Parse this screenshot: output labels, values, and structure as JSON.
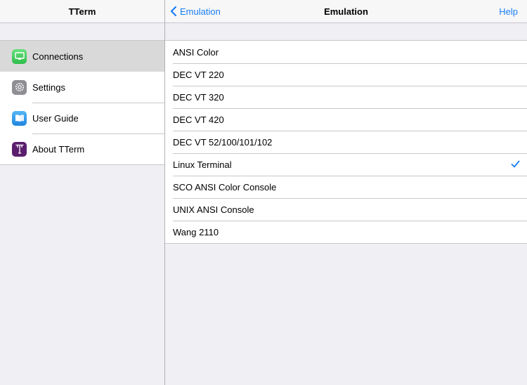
{
  "sidebar": {
    "title": "TTerm",
    "items": [
      {
        "label": "Connections",
        "icon": "monitor-icon",
        "selected": true
      },
      {
        "label": "Settings",
        "icon": "gear-icon",
        "selected": false
      },
      {
        "label": "User Guide",
        "icon": "book-icon",
        "selected": false
      },
      {
        "label": "About TTerm",
        "icon": "tterm-logo-icon",
        "selected": false
      }
    ]
  },
  "header": {
    "back_label": "Emulation",
    "title": "Emulation",
    "help_label": "Help"
  },
  "emulations": {
    "options": [
      {
        "label": "ANSI Color"
      },
      {
        "label": "DEC VT 220"
      },
      {
        "label": "DEC VT 320"
      },
      {
        "label": "DEC VT 420"
      },
      {
        "label": "DEC VT 52/100/101/102"
      },
      {
        "label": "Linux Terminal"
      },
      {
        "label": "SCO ANSI Color Console"
      },
      {
        "label": "UNIX ANSI Console"
      },
      {
        "label": "Wang 2110"
      }
    ],
    "selected": "Linux Terminal"
  },
  "colors": {
    "accent": "#1a7ef5",
    "connections_icon": "#4cd964",
    "settings_icon": "#8e8e93",
    "guide_icon": "#2a9af0",
    "about_icon": "#5b1e6e"
  }
}
